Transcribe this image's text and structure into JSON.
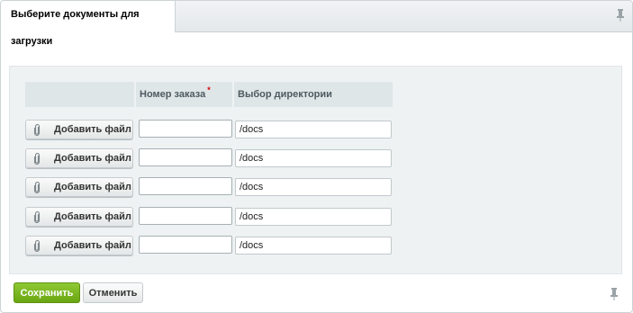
{
  "dialog": {
    "title": "Выберите документы для загрузки",
    "pin_icon": "pin-icon"
  },
  "table": {
    "columns": [
      {
        "label": ""
      },
      {
        "label": "Номер заказа",
        "required_mark": "*"
      },
      {
        "label": "Выбор директории"
      }
    ],
    "rows": [
      {
        "add_label": "Добавить файл",
        "order_value": "",
        "dir_value": "/docs"
      },
      {
        "add_label": "Добавить файл",
        "order_value": "",
        "dir_value": "/docs"
      },
      {
        "add_label": "Добавить файл",
        "order_value": "",
        "dir_value": "/docs"
      },
      {
        "add_label": "Добавить файл",
        "order_value": "",
        "dir_value": "/docs"
      },
      {
        "add_label": "Добавить файл",
        "order_value": "",
        "dir_value": "/docs"
      }
    ],
    "attach_icon": "paperclip-icon"
  },
  "footer": {
    "save_label": "Сохранить",
    "cancel_label": "Отменить"
  },
  "colors": {
    "save_button": "#7ab623",
    "required_mark": "#d60000"
  }
}
